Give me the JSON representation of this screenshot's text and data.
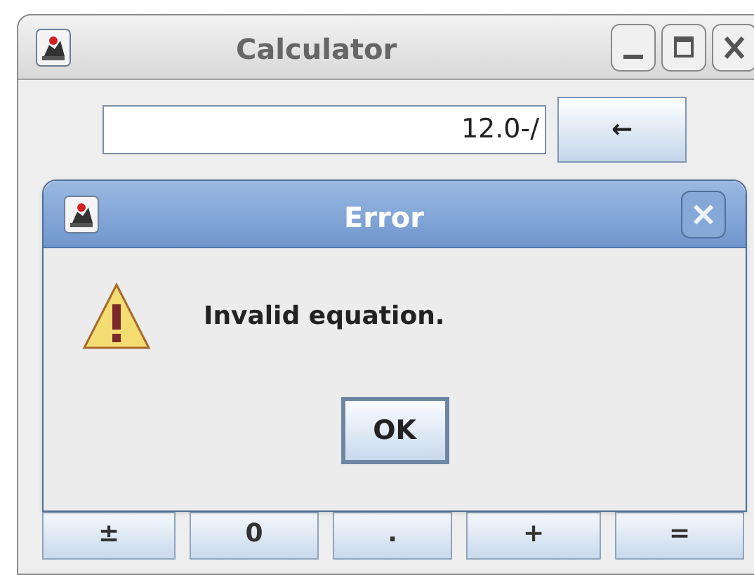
{
  "window": {
    "title": "Calculator"
  },
  "display": {
    "value": "12.0-/"
  },
  "backspace_button": {
    "label": "←"
  },
  "keypad": [
    {
      "label": "±"
    },
    {
      "label": "0"
    },
    {
      "label": "."
    },
    {
      "label": "+"
    },
    {
      "label": "="
    }
  ],
  "dialog": {
    "title": "Error",
    "message": "Invalid equation.",
    "button": "OK"
  }
}
